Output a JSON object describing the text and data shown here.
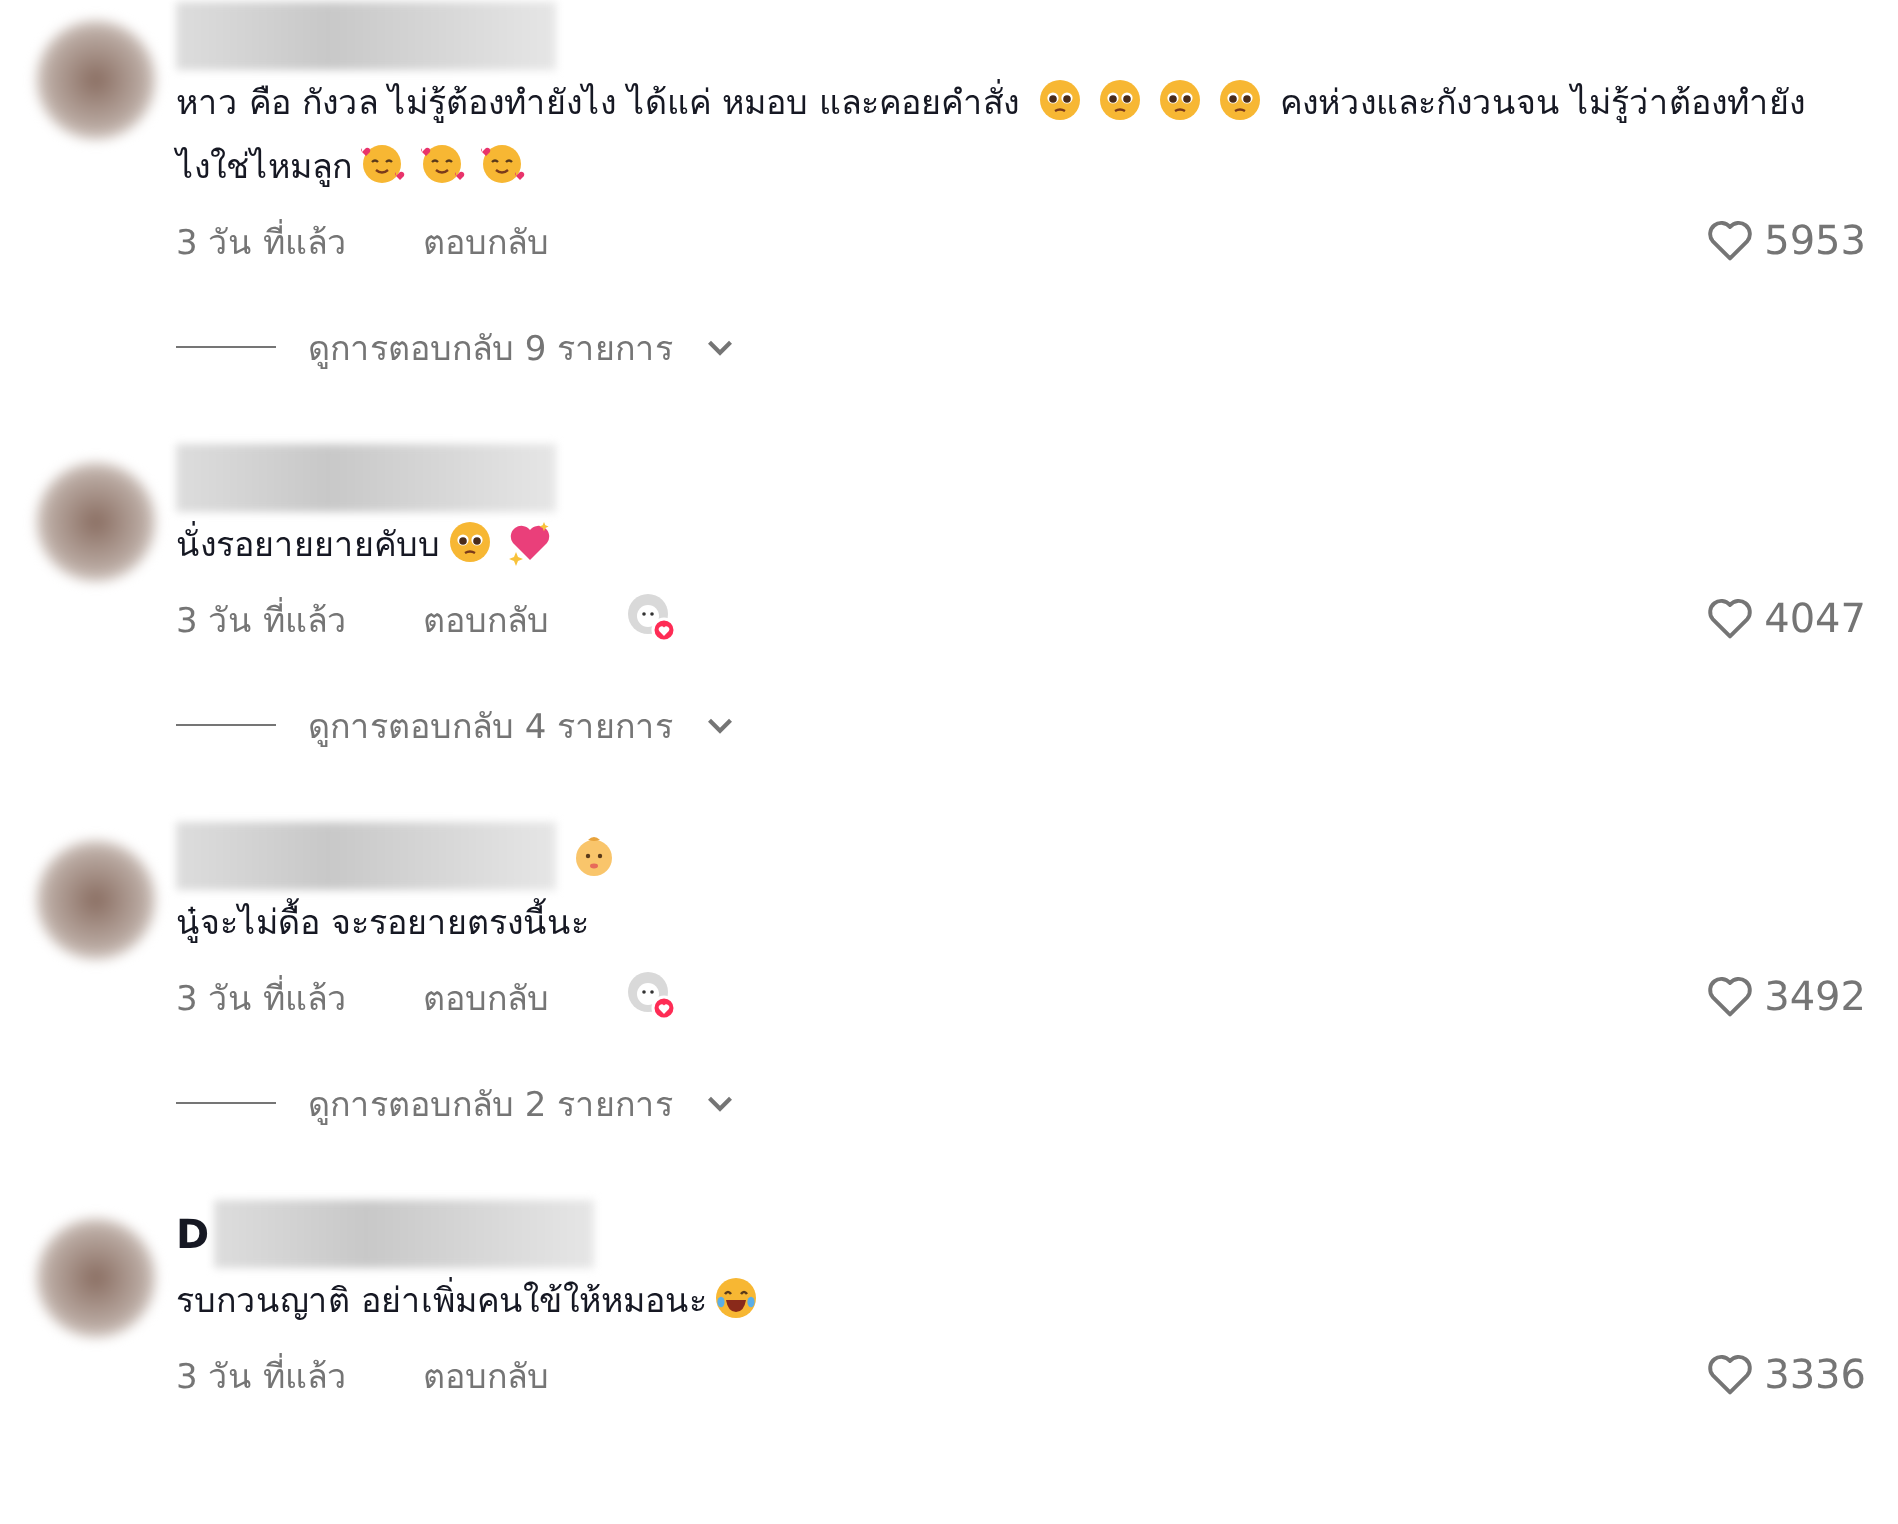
{
  "comments": [
    {
      "body": [
        {
          "kind": "text",
          "text": "หาว คือ กังวล ไม่รู้ต้องทำยังไง ได้แค่ หมอบ และคอยคำสั่ง "
        },
        {
          "kind": "pleading"
        },
        {
          "kind": "pleading"
        },
        {
          "kind": "pleading"
        },
        {
          "kind": "pleading"
        },
        {
          "kind": "text",
          "text": " คงห่วงและกังวนจน ไม่รู้ว่าต้องทำยังไงใช่ไหมลูก"
        },
        {
          "kind": "hearts"
        },
        {
          "kind": "hearts"
        },
        {
          "kind": "hearts"
        }
      ],
      "time": "3 วัน ที่แล้ว",
      "reply": "ตอบกลับ",
      "liked_by_creator": false,
      "likes": "5953",
      "replies": "ดูการตอบกลับ 9 รายการ"
    },
    {
      "body": [
        {
          "kind": "text",
          "text": "นั่งรอยายยายคับบ"
        },
        {
          "kind": "pleading"
        },
        {
          "kind": "sparkle-heart"
        }
      ],
      "time": "3 วัน ที่แล้ว",
      "reply": "ตอบกลับ",
      "liked_by_creator": true,
      "likes": "4047",
      "replies": "ดูการตอบกลับ 4 รายการ"
    },
    {
      "name": [
        {
          "kind": "baby"
        }
      ],
      "body": [
        {
          "kind": "text",
          "text": "นู๋จะไม่ดื้อ จะรอยายตรงนี้นะ"
        }
      ],
      "time": "3 วัน ที่แล้ว",
      "reply": "ตอบกลับ",
      "liked_by_creator": true,
      "likes": "3492",
      "replies": "ดูการตอบกลับ 2 รายการ"
    },
    {
      "name": [
        {
          "kind": "text",
          "text": "D"
        }
      ],
      "body": [
        {
          "kind": "text",
          "text": "รบกวนญาติ อย่าเพิ่มคนใข้ให้หมอนะ"
        },
        {
          "kind": "laughing"
        }
      ],
      "time": "3 วัน ที่แล้ว",
      "reply": "ตอบกลับ",
      "liked_by_creator": false,
      "likes": "3336"
    }
  ]
}
